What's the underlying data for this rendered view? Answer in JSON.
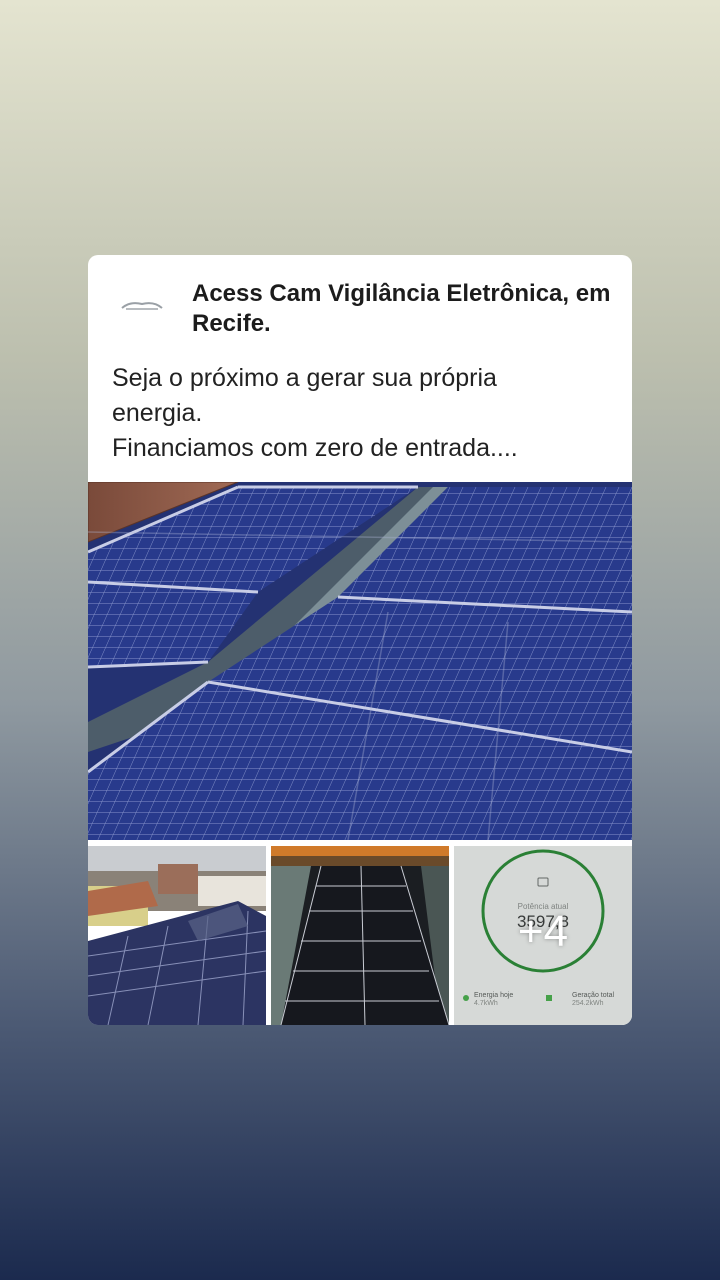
{
  "post": {
    "author": "Acess Cam Vigilância Eletrônica, em Recife.",
    "lines": [
      "Seja o próximo a gerar sua própria",
      "energia.",
      "Financiamos com zero de entrada...."
    ]
  },
  "gallery": {
    "more_label": "+4",
    "app_screen": {
      "title": "Potência atual",
      "value": "3597,8",
      "stats": [
        {
          "label": "Energia hoje",
          "value": "4.7kWh"
        },
        {
          "label": "Geração total",
          "value": "254.2kWh"
        }
      ]
    }
  }
}
